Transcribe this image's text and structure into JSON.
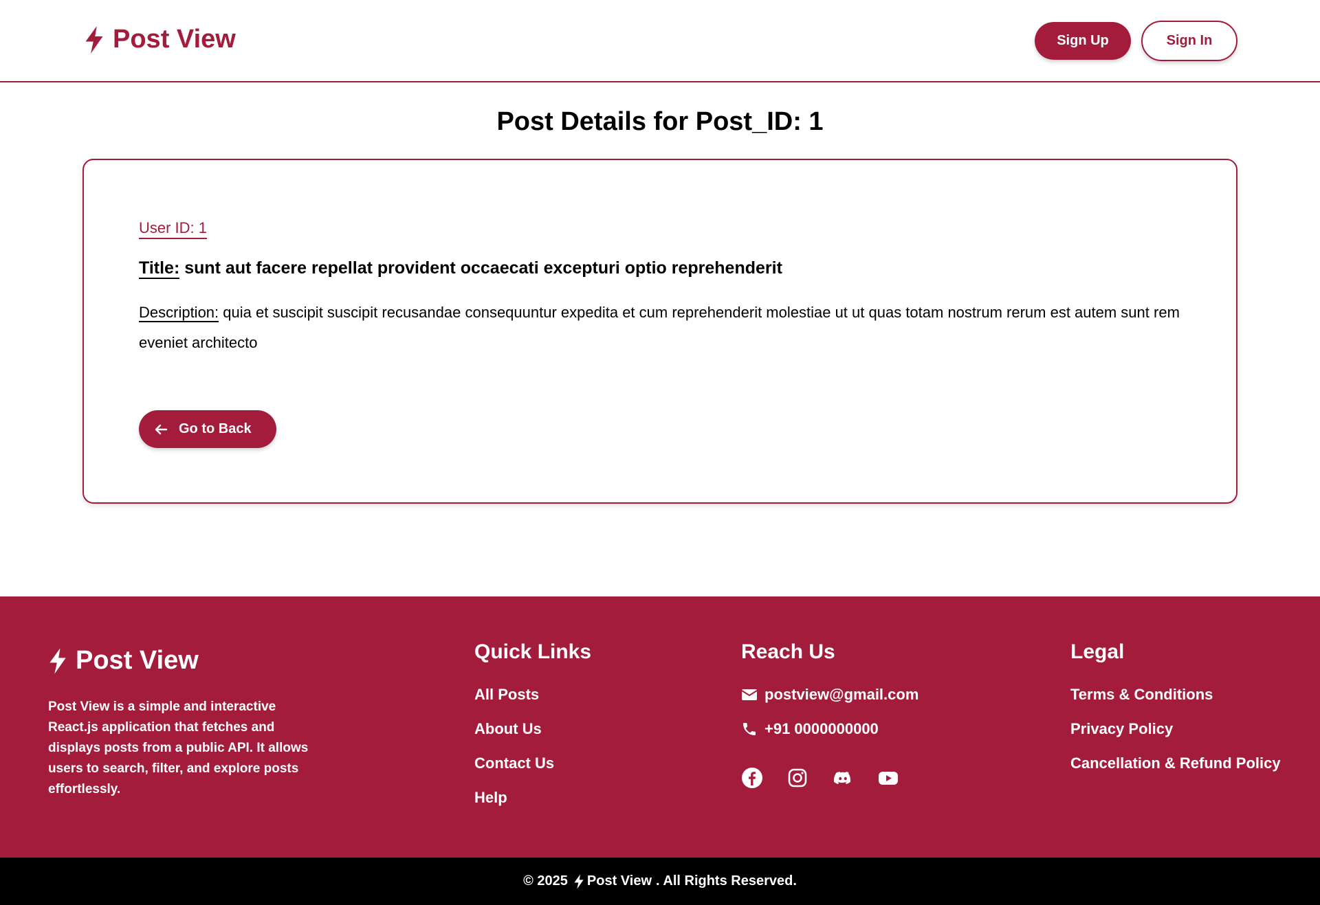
{
  "header": {
    "brand": "Post View",
    "signup_label": "Sign Up",
    "signin_label": "Sign In",
    "accent_color": "#a31c3c"
  },
  "main": {
    "page_title": "Post Details for Post_ID: 1",
    "user_id": "User ID: 1",
    "title_label": "Title:",
    "title_value": "sunt aut facere repellat provident occaecati excepturi optio reprehenderit",
    "description_label": "Description:",
    "description_value": "quia et suscipit suscipit recusandae consequuntur expedita et cum reprehenderit molestiae ut ut quas totam nostrum rerum est autem sunt rem eveniet architecto",
    "back_label": "Go to Back"
  },
  "footer": {
    "brand": "Post View",
    "about": "Post View is a simple and interactive React.js application that fetches and displays posts from a public API. It allows users to search, filter, and explore posts effortlessly.",
    "quick_links": {
      "heading": "Quick Links",
      "items": [
        "All Posts",
        "About Us",
        "Contact Us",
        "Help"
      ]
    },
    "reach_us": {
      "heading": "Reach Us",
      "email": "postview@gmail.com",
      "phone": "+91 0000000000",
      "socials": [
        "facebook-icon",
        "instagram-icon",
        "discord-icon",
        "youtube-icon"
      ]
    },
    "legal": {
      "heading": "Legal",
      "items": [
        "Terms & Conditions",
        "Privacy Policy",
        "Cancellation & Refund Policy"
      ]
    }
  },
  "copyright": {
    "prefix": "© 2025",
    "brand": "Post View",
    "suffix": ". All Rights Reserved."
  }
}
